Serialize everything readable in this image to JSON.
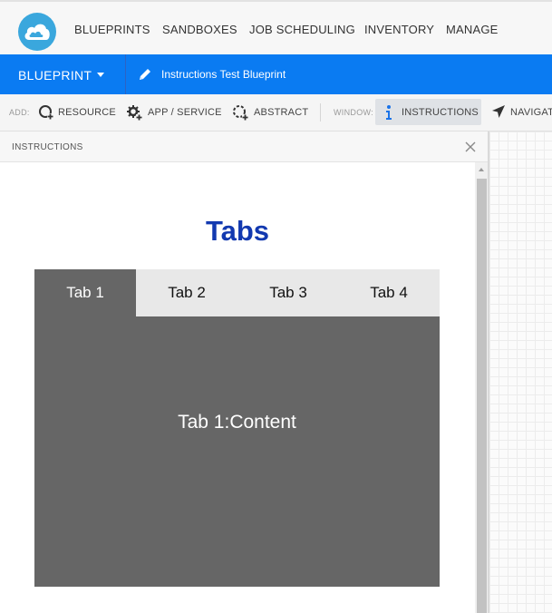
{
  "nav": {
    "items": [
      "BLUEPRINTS",
      "SANDBOXES",
      "JOB SCHEDULING",
      "INVENTORY",
      "MANAGE"
    ]
  },
  "blueprint_bar": {
    "dropdown_label": "BLUEPRINT",
    "title": "Instructions Test Blueprint"
  },
  "toolbar": {
    "add_label": "ADD:",
    "resource": "RESOURCE",
    "app_service": "APP / SERVICE",
    "abstract": "ABSTRACT",
    "window_label": "WINDOW:",
    "instructions": "INSTRUCTIONS",
    "navigator": "NAVIGAT"
  },
  "panel": {
    "title": "INSTRUCTIONS"
  },
  "content": {
    "heading": "Tabs",
    "tabs": [
      "Tab 1",
      "Tab 2",
      "Tab 3",
      "Tab 4"
    ],
    "active_tab_index": 0,
    "active_content": "Tab 1:Content"
  },
  "colors": {
    "brand_blue": "#0a7bf2",
    "heading_blue": "#1239b0",
    "tab_active": "#666666",
    "tab_inactive": "#e8e8e8"
  }
}
